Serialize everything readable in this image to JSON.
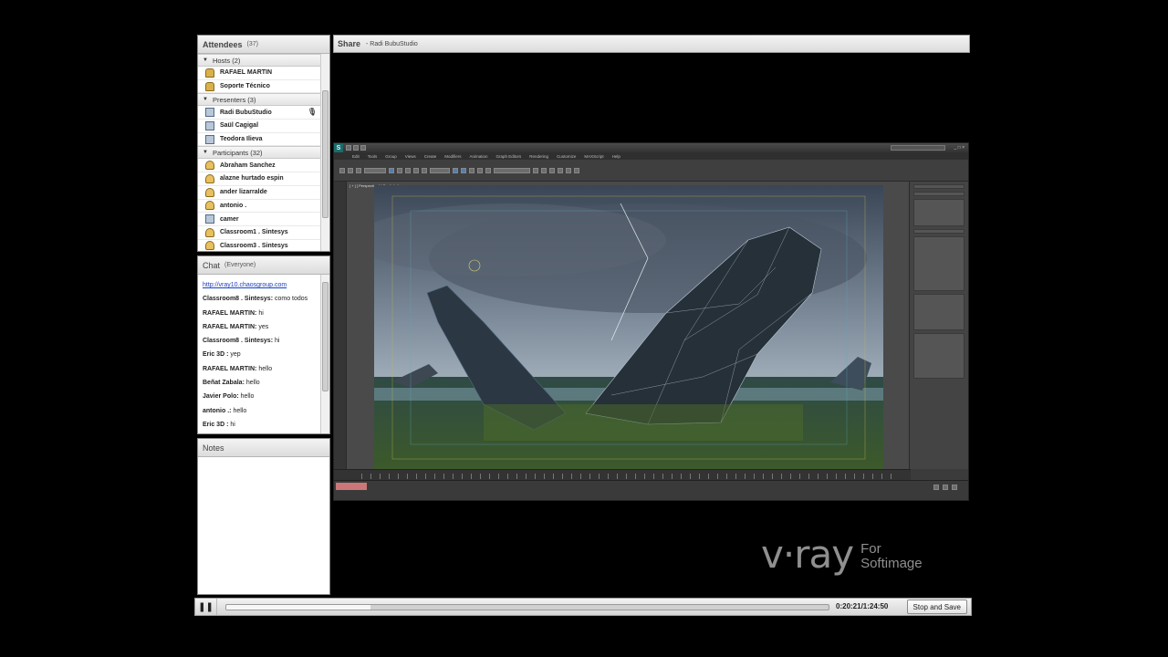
{
  "attendees": {
    "title": "Attendees",
    "count": "(37)",
    "groups": {
      "hosts": {
        "label": "Hosts (2)",
        "items": [
          "RAFAEL MARTIN",
          "Soporte Técnico"
        ]
      },
      "presenters": {
        "label": "Presenters (3)",
        "items": [
          "Radi BubuStudio",
          "Saül Cagigal",
          "Teodora Ilieva"
        ]
      },
      "participants": {
        "label": "Participants (32)",
        "items": [
          "Abraham Sanchez",
          "alazne hurtado espin",
          "ander lizarralde",
          "antonio .",
          "camer",
          "Classroom1 . Sintesys",
          "Classroom3 . Sintesys"
        ]
      }
    }
  },
  "chat": {
    "title": "Chat",
    "scope": "(Everyone)",
    "messages": [
      {
        "who": "",
        "text": "http://vray10.chaosgroup.com",
        "link": true
      },
      {
        "who": "Classroom8 . Sintesys:",
        "text": " como todos"
      },
      {
        "who": "RAFAEL MARTIN:",
        "text": " hi"
      },
      {
        "who": "RAFAEL MARTIN:",
        "text": " yes"
      },
      {
        "who": "Classroom8 . Sintesys:",
        "text": " hi"
      },
      {
        "who": "Eric  3D :",
        "text": " yep"
      },
      {
        "who": "RAFAEL MARTIN:",
        "text": " hello"
      },
      {
        "who": "Beñat Zabala:",
        "text": " hello"
      },
      {
        "who": "Javier Polo:",
        "text": " hello"
      },
      {
        "who": "antonio .:",
        "text": " hello"
      },
      {
        "who": "Eric  3D :",
        "text": " hi"
      }
    ]
  },
  "notes": {
    "title": "Notes"
  },
  "share": {
    "title": "Share",
    "presenter": "- Radi BubuStudio"
  },
  "max_window": {
    "menu": [
      "Edit",
      "Tools",
      "Group",
      "Views",
      "Create",
      "Modifiers",
      "Animation",
      "Graph Editors",
      "Rendering",
      "Customize",
      "MAXScript",
      "Help"
    ],
    "viewport_label": "[ + ] [ Perspective ] [ Realistic ]"
  },
  "player": {
    "position": "0:20:21",
    "duration": "1:24:50",
    "time_text": "0:20:21/1:24:50",
    "progress_fraction": 0.24,
    "stop_label": "Stop and Save"
  },
  "branding": {
    "logo": "v·ray",
    "line1": "For",
    "line2": "Softimage"
  }
}
